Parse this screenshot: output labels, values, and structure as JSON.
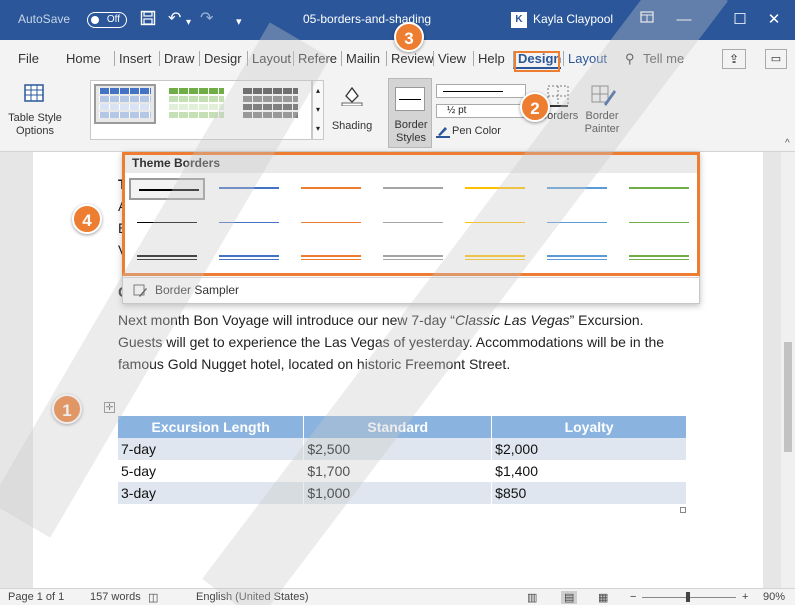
{
  "titlebar": {
    "autosave_label": "AutoSave",
    "autosave_state": "Off",
    "filename": "05-borders-and-shading",
    "user": "Kayla Claypool",
    "user_initial": "K"
  },
  "tabs": [
    "File",
    "Home",
    "Insert",
    "Draw",
    "Design",
    "Layout",
    "References",
    "Mailings",
    "Review",
    "View",
    "Help",
    "Design",
    "Layout"
  ],
  "tabs_display": [
    "File",
    "Home",
    "Insert",
    "Draw",
    "Desigr",
    "Layout",
    "Refere",
    "Mailin",
    "Review",
    "View",
    "Help",
    "Design",
    "Layout"
  ],
  "tell_me": "Tell me",
  "ribbon": {
    "table_style_options": "Table Style Options",
    "shading": "Shading",
    "border_styles": "Border Styles",
    "pen_weight": "½ pt",
    "pen_color": "Pen Color",
    "borders": "Borders",
    "border_painter": "Border Painter"
  },
  "dropdown": {
    "header": "Theme Borders",
    "sampler": "Border Sampler",
    "colors": [
      "#000000",
      "#4472c4",
      "#ed7d31",
      "#a5a5a5",
      "#ffc000",
      "#5b9bd5",
      "#70ad47"
    ]
  },
  "document": {
    "paragraph_before_italic": "Next month Bon Voyage will introduce our new 7-day “",
    "paragraph_italic": "Classic Las Vegas",
    "paragraph_after_italic": "” Excursion. Guests will get to experience the Las Vegas of yesterday. Accommodations will be in the famous Gold Nugget hotel, located on historic Freemont Street.",
    "partial_letters": [
      "T",
      "A",
      "E",
      "V",
      "C"
    ],
    "table": {
      "headers": [
        "Excursion Length",
        "Standard",
        "Loyalty"
      ],
      "rows": [
        [
          "7-day",
          "$2,500",
          "$2,000"
        ],
        [
          "5-day",
          "$1,700",
          "$1,400"
        ],
        [
          "3-day",
          "$1,000",
          "$850"
        ]
      ]
    }
  },
  "callouts": [
    "1",
    "2",
    "3",
    "4"
  ],
  "statusbar": {
    "page": "Page 1 of 1",
    "words": "157 words",
    "language": "English (United States)",
    "zoom": "90%"
  },
  "colors": {
    "word_blue": "#2b579a",
    "callout_orange": "#ed7d31",
    "table_header": "#8ab4df"
  }
}
